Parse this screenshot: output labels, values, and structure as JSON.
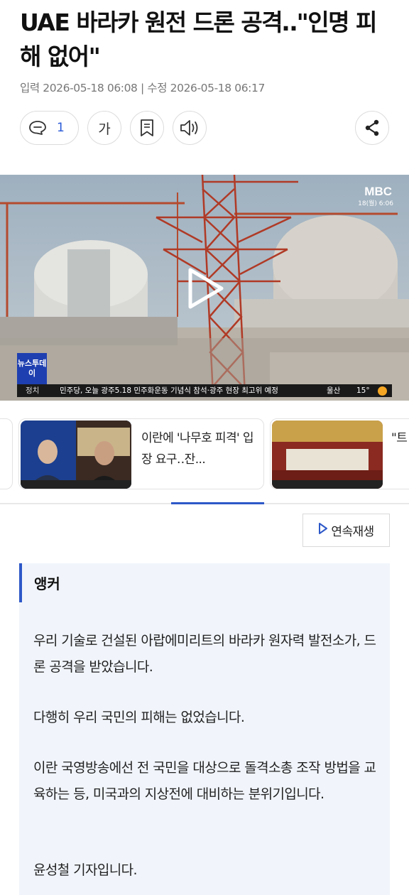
{
  "article": {
    "headline": "UAE 바라카 원전 드론 공격‥\"인명 피해 없어\"",
    "dates": "입력 2026-05-18 06:08 | 수정 2026-05-18 06:17"
  },
  "toolbar": {
    "comment_count": "1",
    "font_size_label": "가",
    "icons": [
      "comment-icon",
      "bookmark-icon",
      "speaker-icon",
      "share-icon"
    ]
  },
  "video": {
    "channel_logo": "MBC",
    "channel_time": "18(월) 6:06",
    "program_badge": "뉴스투데이",
    "ticker_category": "정치",
    "ticker_text": "민주당, 오늘 광주5.18 민주화운동 기념식 참석·광주 현장 최고위 예정",
    "weather_region": "울산",
    "weather_temp": "15°"
  },
  "related": [
    {
      "title": ""
    },
    {
      "title": "이란에 '나무호 피격' 입장 요구‥잔..."
    },
    {
      "title": "\"트 반미"
    }
  ],
  "autoplay_label": "연속재생",
  "body": {
    "anchor_label": "앵커",
    "paragraphs": [
      "우리 기술로 건설된 아랍에미리트의 바라카 원자력 발전소가, 드론 공격을 받았습니다.",
      "다행히 우리 국민의 피해는 없었습니다.",
      "이란 국영방송에선 전 국민을 대상으로 돌격소총 조작 방법을 교육하는 등, 미국과의 지상전에 대비하는 분위기입니다.",
      "윤성철 기자입니다."
    ]
  },
  "colors": {
    "accent": "#2d58c8",
    "comment_count": "#2a5bd7",
    "article_bg": "#f1f5fb"
  }
}
